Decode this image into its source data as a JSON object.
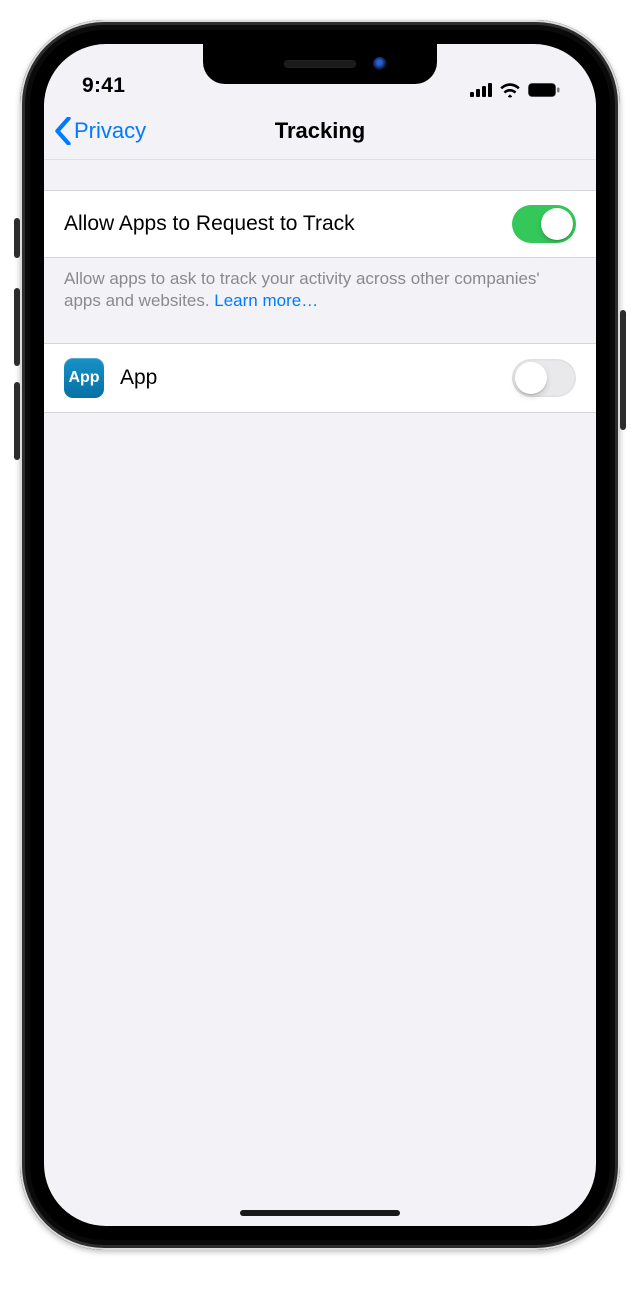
{
  "status": {
    "time": "9:41"
  },
  "nav": {
    "back_label": "Privacy",
    "title": "Tracking"
  },
  "main_toggle": {
    "label": "Allow Apps to Request to Track",
    "on": true
  },
  "footer": {
    "text": "Allow apps to ask to track your activity across other companies' apps and websites. ",
    "link": "Learn more…"
  },
  "apps": [
    {
      "icon_label": "App",
      "name": "App",
      "on": false
    }
  ]
}
